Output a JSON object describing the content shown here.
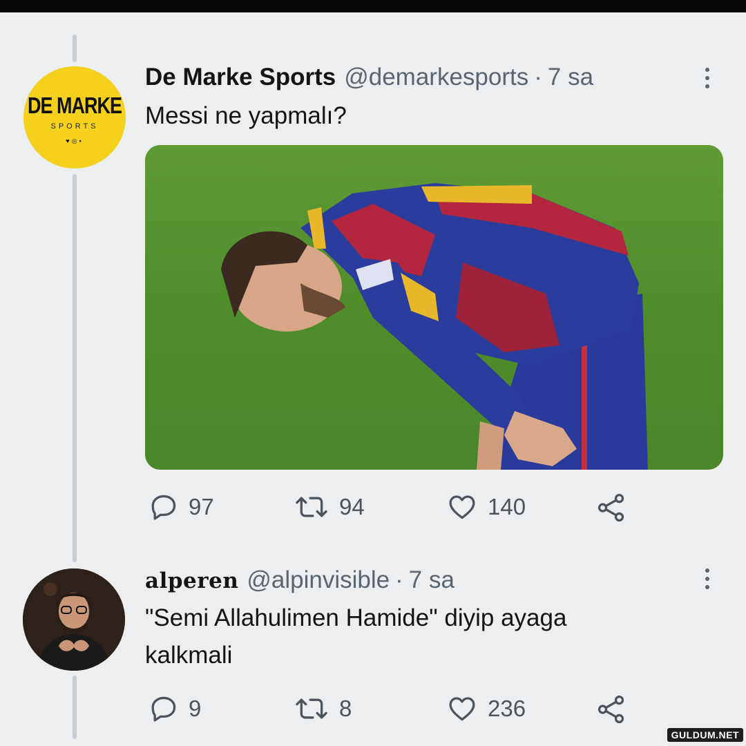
{
  "tweets": [
    {
      "name": "De Marke Sports",
      "handle": "@demarkesports",
      "separator": "·",
      "time": "7 sa",
      "text": "Messi ne yapmalı?",
      "avatar_logo": {
        "main": "DE MARKE",
        "sub": "SPORTS",
        "social": "♥◎▪"
      },
      "stats": {
        "replies": "97",
        "retweets": "94",
        "likes": "140"
      }
    },
    {
      "name": "alperen",
      "handle": "@alpinvisible",
      "separator": "·",
      "time": "7 sa",
      "text_line1": "\"Semi Allahulimen Hamide\" diyip ayaga",
      "text_line2": "kalkmali",
      "stats": {
        "replies": "9",
        "retweets": "8",
        "likes": "236"
      }
    }
  ],
  "icons": {
    "reply": "reply-icon",
    "retweet": "retweet-icon",
    "like": "heart-icon",
    "share": "share-icon",
    "more": "more-vertical-icon"
  },
  "colors": {
    "background": "#eceef0",
    "avatar_yellow": "#f5d11e",
    "muted_text": "#5b6570",
    "thread_line": "#c9ced3"
  },
  "watermark": "GULDUM.NET"
}
